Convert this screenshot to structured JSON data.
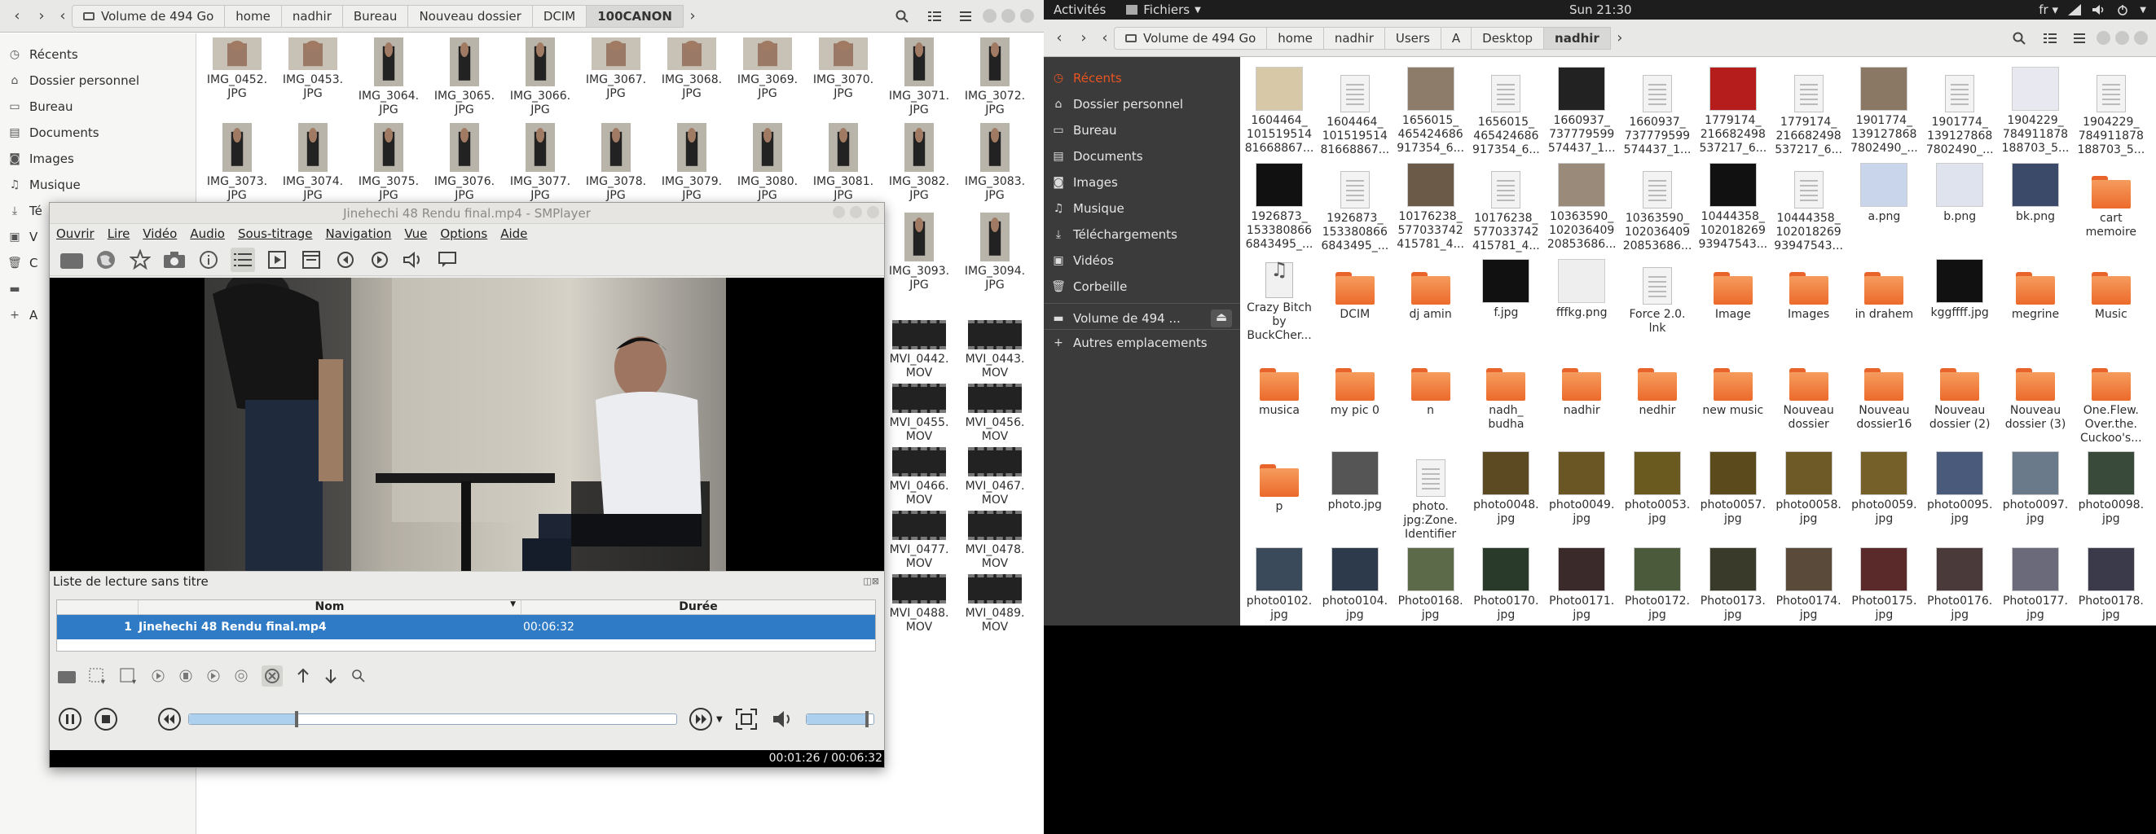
{
  "left_fm": {
    "path": [
      "Volume de 494 Go",
      "home",
      "nadhir",
      "Bureau",
      "Nouveau dossier",
      "DCIM",
      "100CANON"
    ],
    "sidebar": [
      "Récents",
      "Dossier personnel",
      "Bureau",
      "Documents",
      "Images",
      "Musique",
      "Té",
      "V",
      "C",
      "",
      "A"
    ],
    "row1": [
      "IMG_0452.\nJPG",
      "IMG_0453.\nJPG",
      "IMG_3064.\nJPG",
      "IMG_3065.\nJPG",
      "IMG_3066.\nJPG",
      "IMG_3067.\nJPG",
      "IMG_3068.\nJPG",
      "IMG_3069.\nJPG",
      "IMG_3070.\nJPG",
      "IMG_3071.\nJPG",
      "IMG_3072.\nJPG"
    ],
    "row2": [
      "IMG_3073.\nJPG",
      "IMG_3074.\nJPG",
      "IMG_3075.\nJPG",
      "IMG_3076.\nJPG",
      "IMG_3077.\nJPG",
      "IMG_3078.\nJPG",
      "IMG_3079.\nJPG",
      "IMG_3080.\nJPG",
      "IMG_3081.\nJPG",
      "IMG_3082.\nJPG",
      "IMG_3083.\nJPG"
    ],
    "col_right": [
      "IMG_3093.\nJPG",
      "IMG_3094.\nJPG",
      "MVI_0442.\nMOV",
      "MVI_0443.\nMOV",
      "MVI_0455.\nMOV",
      "MVI_0456.\nMOV",
      "MVI_0466.\nMOV",
      "MVI_0467.\nMOV",
      "MVI_0477.\nMOV",
      "MVI_0478.\nMOV",
      "MVI_0488.\nMOV",
      "MVI_0489.\nMOV"
    ]
  },
  "smplayer": {
    "title": "Jinehechi 48 Rendu final.mp4 - SMPlayer",
    "menu": [
      "Ouvrir",
      "Lire",
      "Vidéo",
      "Audio",
      "Sous-titrage",
      "Navigation",
      "Vue",
      "Options",
      "Aide"
    ],
    "playlist_title": "Liste de lecture sans titre",
    "col_name": "Nom",
    "col_duration": "Durée",
    "row_index": "1",
    "row_name": "Jinehechi 48 Rendu final.mp4",
    "row_duration": "00:06:32",
    "time": "00:01:26 / 00:06:32",
    "progress": 0.22,
    "volume": 0.9
  },
  "topbar": {
    "activities": "Activités",
    "app": "Fichiers",
    "clock": "Sun 21:30",
    "lang": "fr"
  },
  "right_fm": {
    "path": [
      "Volume de 494 Go",
      "home",
      "nadhir",
      "Users",
      "A",
      "Desktop",
      "nadhir"
    ],
    "sidebar": [
      "Récents",
      "Dossier personnel",
      "Bureau",
      "Documents",
      "Images",
      "Musique",
      "Téléchargements",
      "Vidéos",
      "Corbeille",
      "Volume de 494 ...",
      "Autres emplacements"
    ],
    "files": [
      [
        "1604464_\n101519514\n81668867...",
        "img",
        "#d7c9a8"
      ],
      [
        "1604464_\n101519514\n81668867...",
        "doc",
        ""
      ],
      [
        "1656015_\n465424686\n917354_6...",
        "img",
        "#8d7c6a"
      ],
      [
        "1656015_\n465424686\n917354_6...",
        "doc",
        ""
      ],
      [
        "1660937_\n737779599\n574437_1...",
        "img",
        "#222"
      ],
      [
        "1660937_\n737779599\n574437_1...",
        "doc",
        ""
      ],
      [
        "1779174_\n216682498\n537217_6...",
        "img",
        "#b51c1c"
      ],
      [
        "1779174_\n216682498\n537217_6...",
        "doc",
        ""
      ],
      [
        "1901774_\n139127868\n7802490_...",
        "img",
        "#8a7764"
      ],
      [
        "1901774_\n139127868\n7802490_...",
        "doc",
        ""
      ],
      [
        "1904229_\n784911878\n188703_5...",
        "img",
        "#e8e8f0"
      ],
      [
        "1904229_\n784911878\n188703_5...",
        "doc",
        ""
      ],
      [
        "1926873_\n153380866\n6843495_...",
        "img",
        "#111"
      ],
      [
        "1926873_\n153380866\n6843495_...",
        "doc",
        ""
      ],
      [
        "10176238_\n577033742\n415781_4...",
        "img",
        "#6b5a48"
      ],
      [
        "10176238_\n577033742\n415781_4...",
        "doc",
        ""
      ],
      [
        "10363590_\n102036409\n20853686...",
        "img",
        "#9a8a7a"
      ],
      [
        "10363590_\n102036409\n20853686...",
        "doc",
        ""
      ],
      [
        "10444358_\n102018269\n93947543...",
        "img",
        "#111"
      ],
      [
        "10444358_\n102018269\n93947543...",
        "doc",
        ""
      ],
      [
        "a.png",
        "img",
        "#c9d5ea"
      ],
      [
        "b.png",
        "img",
        "#dfe3ee"
      ],
      [
        "bk.png",
        "img",
        "#3c4a6a"
      ],
      [
        "cart\nmemoire",
        "folder",
        ""
      ],
      [
        "Crazy Bitch\nby\nBuckCher...",
        "audio",
        ""
      ],
      [
        "DCIM",
        "folder",
        ""
      ],
      [
        "dj amin",
        "folder",
        ""
      ],
      [
        "f.jpg",
        "img",
        "#111"
      ],
      [
        "fffkg.png",
        "img",
        "#eee"
      ],
      [
        "Force 2.0.\nlnk",
        "doc",
        ""
      ],
      [
        "Image",
        "folder",
        ""
      ],
      [
        "Images",
        "folder",
        ""
      ],
      [
        "in drahem",
        "folder",
        ""
      ],
      [
        "kggffff.jpg",
        "img",
        "#111"
      ],
      [
        "megrine",
        "folder",
        ""
      ],
      [
        "Music",
        "folder",
        ""
      ],
      [
        "musica",
        "folder",
        ""
      ],
      [
        "my pic 0",
        "folder",
        ""
      ],
      [
        "n",
        "folder",
        ""
      ],
      [
        "nadh_\nbudha",
        "folder",
        ""
      ],
      [
        "nadhir",
        "folder",
        ""
      ],
      [
        "nedhir",
        "folder",
        ""
      ],
      [
        "new music",
        "folder",
        ""
      ],
      [
        "Nouveau\ndossier",
        "folder",
        ""
      ],
      [
        "Nouveau\ndossier16",
        "folder",
        ""
      ],
      [
        "Nouveau\ndossier (2)",
        "folder",
        ""
      ],
      [
        "Nouveau\ndossier (3)",
        "folder",
        ""
      ],
      [
        "One.Flew.\nOver.the.\nCuckoo's...",
        "folder",
        ""
      ],
      [
        "p",
        "folder",
        ""
      ],
      [
        "photo.jpg",
        "img",
        "#555"
      ],
      [
        "photo.\njpg:Zone.\nIdentifier",
        "doc",
        ""
      ],
      [
        "photo0048.\njpg",
        "img",
        "#5c4a22"
      ],
      [
        "photo0049.\njpg",
        "img",
        "#6a5524"
      ],
      [
        "photo0053.\njpg",
        "img",
        "#6b5a20"
      ],
      [
        "photo0057.\njpg",
        "img",
        "#5a4a1c"
      ],
      [
        "photo0058.\njpg",
        "img",
        "#6e5a26"
      ],
      [
        "photo0059.\njpg",
        "img",
        "#76602a"
      ],
      [
        "photo0095.\njpg",
        "img",
        "#4a5a7a"
      ],
      [
        "photo0097.\njpg",
        "img",
        "#6a7a8a"
      ],
      [
        "photo0098.\njpg",
        "img",
        "#3a4a3a"
      ],
      [
        "photo0102.\njpg",
        "img",
        "#3a4a5a"
      ],
      [
        "photo0104.\njpg",
        "img",
        "#2c3a4c"
      ],
      [
        "Photo0168.\njpg",
        "img",
        "#5c6a4a"
      ],
      [
        "Photo0170.\njpg",
        "img",
        "#2a3a2a"
      ],
      [
        "Photo0171.\njpg",
        "img",
        "#3a2a2a"
      ],
      [
        "Photo0172.\njpg",
        "img",
        "#4a5a3a"
      ],
      [
        "Photo0173.\njpg",
        "img",
        "#3a3a2a"
      ],
      [
        "Photo0174.\njpg",
        "img",
        "#5a4a3a"
      ],
      [
        "Photo0175.\njpg",
        "img",
        "#5a2a2a"
      ],
      [
        "Photo0176.\njpg",
        "img",
        "#4a3a3a"
      ],
      [
        "Photo0177.\njpg",
        "img",
        "#6a6a7a"
      ],
      [
        "Photo0178.\njpg",
        "img",
        "#3a3a4a"
      ]
    ]
  }
}
